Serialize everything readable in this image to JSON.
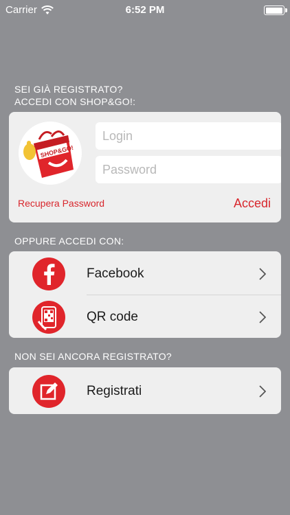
{
  "status_bar": {
    "carrier": "Carrier",
    "time": "6:52 PM"
  },
  "login_section": {
    "label_line1": "SEI GIÀ REGISTRATO?",
    "label_line2": "ACCEDI CON SHOP&GO!:",
    "login_placeholder": "Login",
    "password_placeholder": "Password",
    "recover_label": "Recupera Password",
    "submit_label": "Accedi"
  },
  "alt_login_section": {
    "label": "OPPURE ACCEDI CON:",
    "items": [
      {
        "label": "Facebook",
        "icon": "facebook-icon"
      },
      {
        "label": "QR code",
        "icon": "qr-code-icon"
      }
    ]
  },
  "register_section": {
    "label": "NON SEI ANCORA REGISTRATO?",
    "item_label": "Registrati",
    "icon": "edit-icon"
  },
  "colors": {
    "background": "#8e8f93",
    "accent": "#d8262c",
    "card": "#efefef"
  }
}
